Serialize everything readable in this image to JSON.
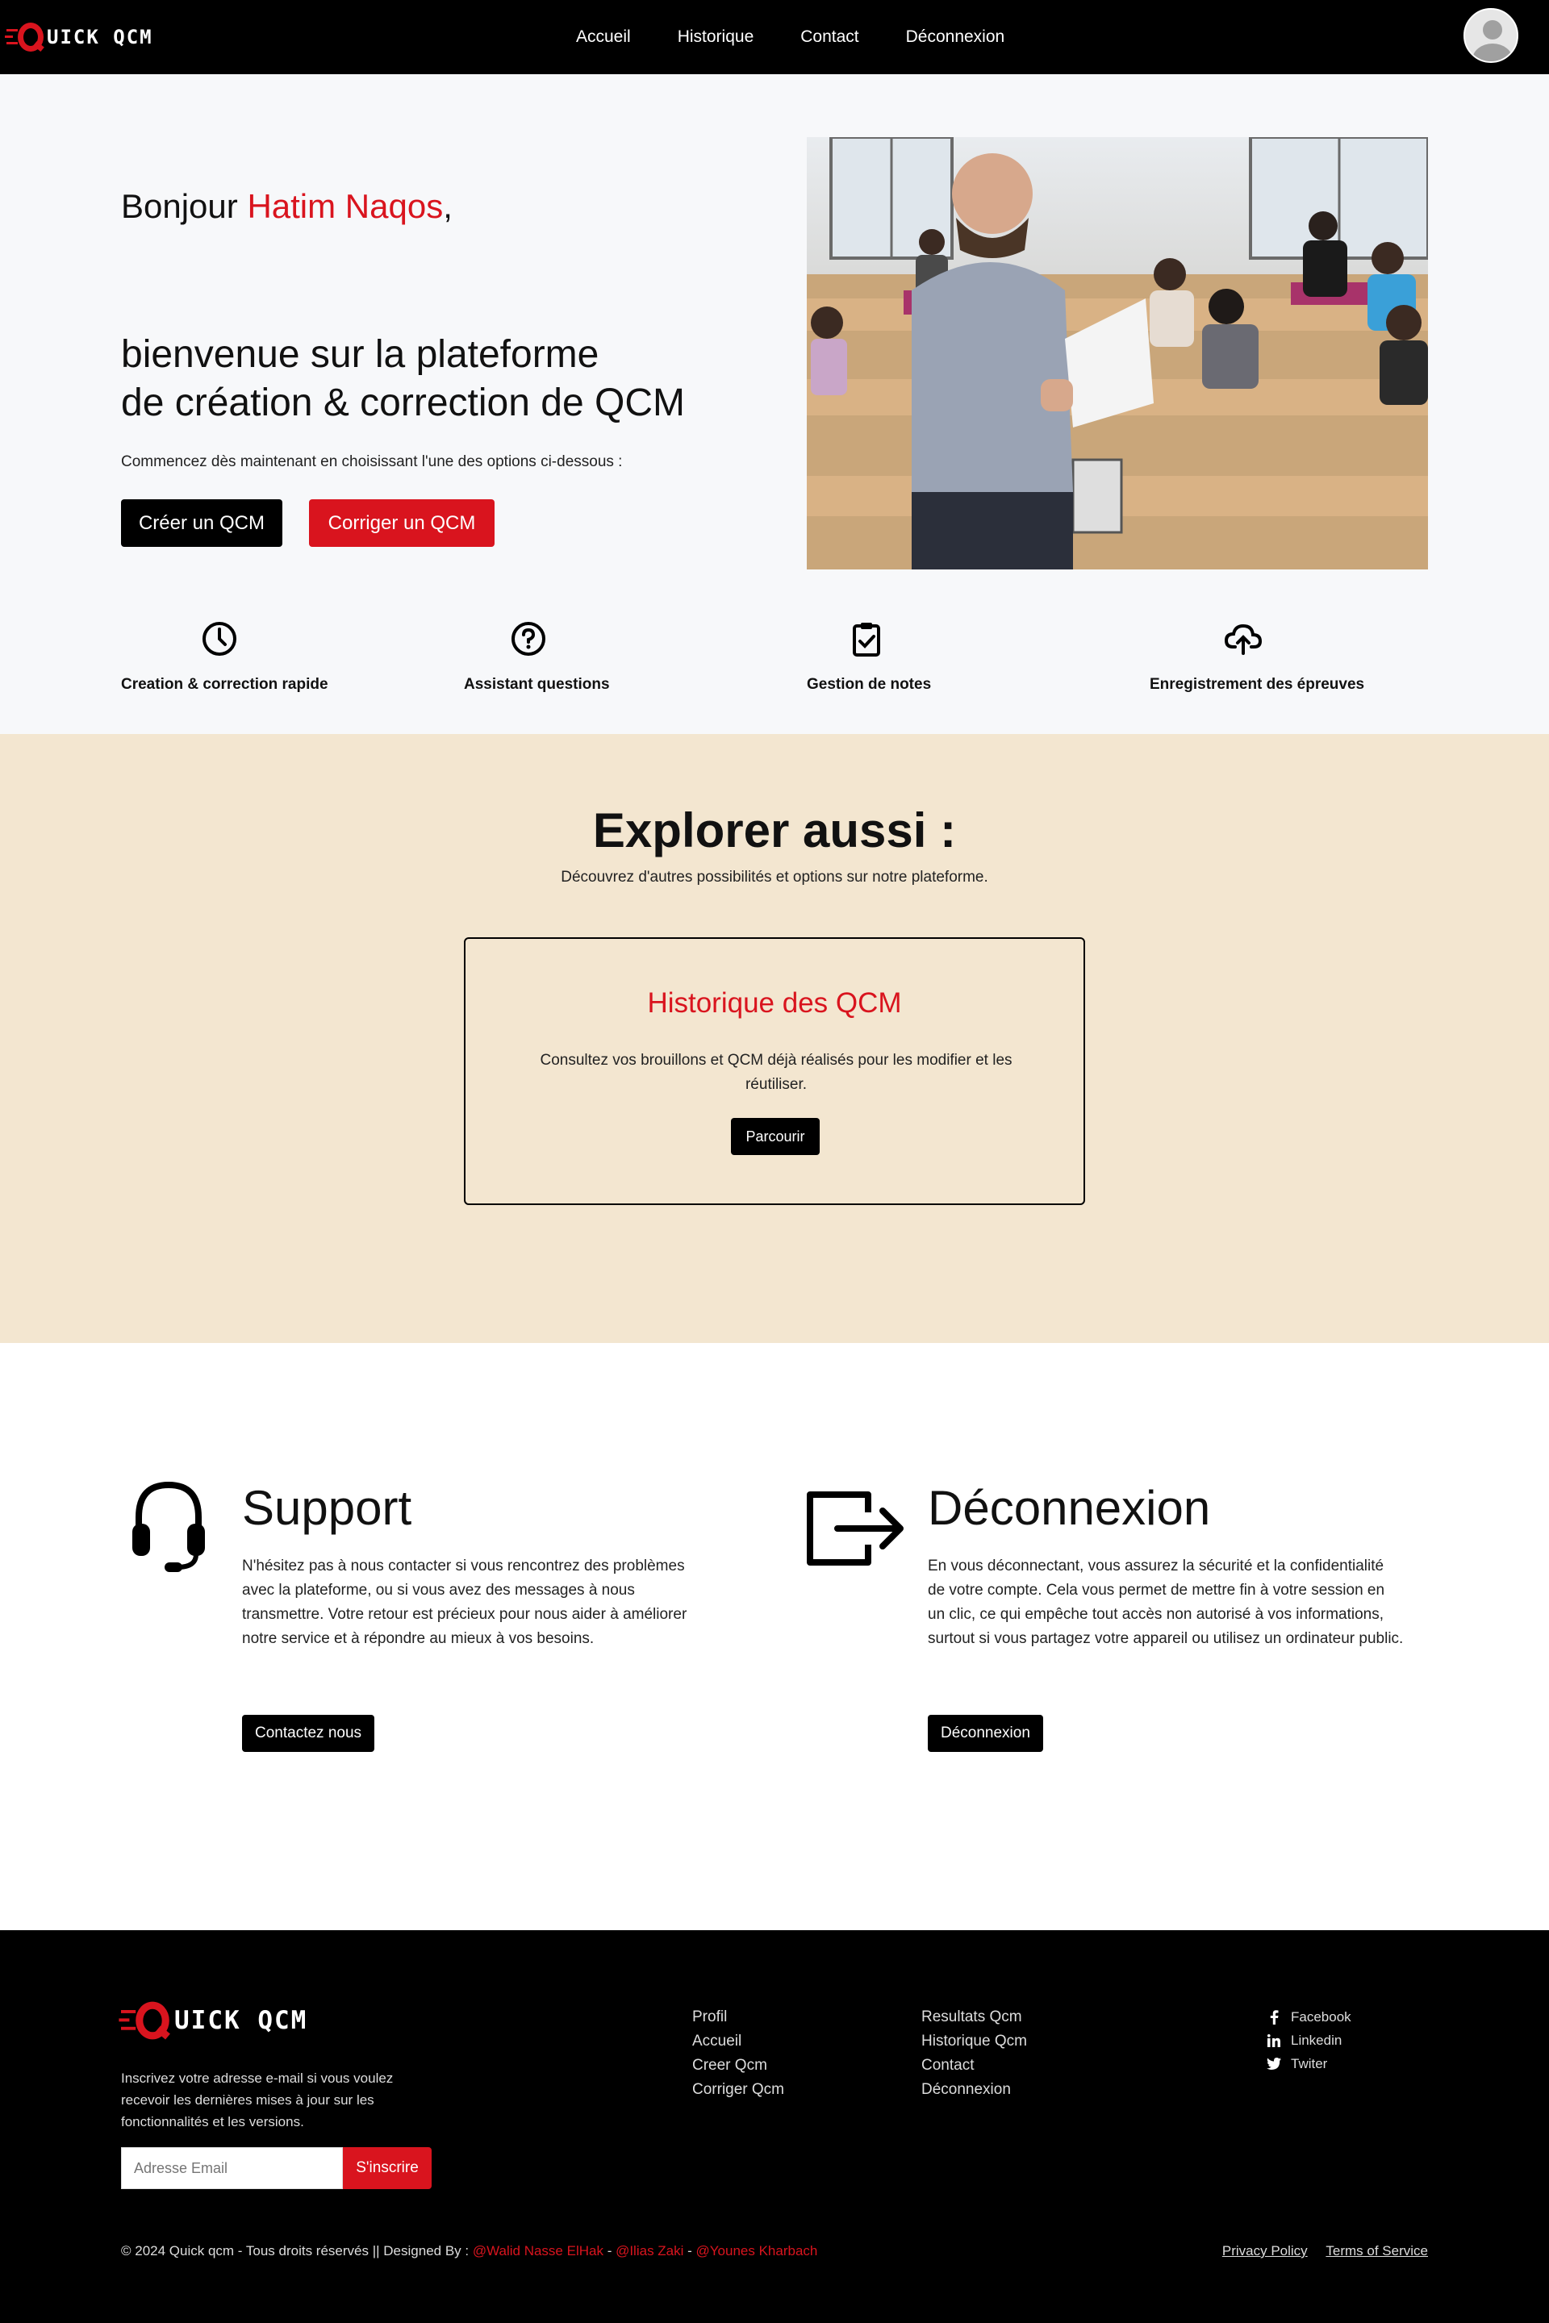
{
  "brand": {
    "name": "UICK QCM",
    "accent_color": "#d9141e"
  },
  "nav": {
    "items": [
      "Accueil",
      "Historique",
      "Contact",
      "Déconnexion"
    ],
    "avatar_icon": "user-avatar-icon"
  },
  "hero": {
    "greeting_prefix": "Bonjour ",
    "user_name": "Hatim Naqos",
    "greeting_suffix": ",",
    "welcome_line1": "bienvenue sur la plateforme",
    "welcome_line2": "de création & correction de QCM",
    "subtitle": "Commencez dès maintenant en choisissant l'une des options ci-dessous :",
    "create_label": "Créer un QCM",
    "correct_label": "Corriger un QCM"
  },
  "features": [
    {
      "icon": "clock-icon",
      "label": "Creation & correction rapide"
    },
    {
      "icon": "question-circle-icon",
      "label": "Assistant questions"
    },
    {
      "icon": "clipboard-check-icon",
      "label": "Gestion de notes"
    },
    {
      "icon": "cloud-upload-icon",
      "label": "Enregistrement des épreuves"
    }
  ],
  "explore": {
    "title": "Explorer aussi :",
    "subtitle": "Découvrez d'autres possibilités et options sur notre plateforme.",
    "card_title": "Historique des QCM",
    "card_text": "Consultez vos brouillons et QCM déjà réalisés pour les modifier et les réutiliser.",
    "card_button": "Parcourir"
  },
  "support": {
    "icon": "headset-icon",
    "title": "Support",
    "text": "N'hésitez pas à nous contacter si vous rencontrez des problèmes avec la plateforme, ou si vous avez des messages à nous transmettre. Votre retour est précieux pour nous aider à améliorer notre service et à répondre au mieux à vos besoins.",
    "button": "Contactez nous"
  },
  "logout": {
    "icon": "logout-icon",
    "title": "Déconnexion",
    "text": "En vous déconnectant, vous assurez la sécurité et la confidentialité de votre compte. Cela vous permet de mettre fin à votre session en un clic, ce qui empêche tout accès non autorisé à vos informations, surtout si vous partagez votre appareil ou utilisez un ordinateur public.",
    "button": "Déconnexion"
  },
  "footer": {
    "description": "Inscrivez votre adresse e-mail si vous voulez recevoir les dernières mises à jour sur les fonctionnalités et les versions.",
    "email_placeholder": "Adresse Email",
    "subscribe_label": "S'inscrire",
    "col1": [
      "Profil",
      "Accueil",
      "Creer Qcm",
      "Corriger Qcm"
    ],
    "col2": [
      "Resultats Qcm",
      "Historique Qcm",
      "Contact",
      "Déconnexion"
    ],
    "social": [
      {
        "icon": "facebook-icon",
        "label": "Facebook"
      },
      {
        "icon": "linkedin-icon",
        "label": "Linkedin"
      },
      {
        "icon": "twitter-icon",
        "label": "Twiter"
      }
    ],
    "copyright_prefix": "© 2024 Quick qcm - Tous droits réservés || Designed By : ",
    "developers": [
      "@Walid Nasse ElHak",
      "@Ilias Zaki",
      "@Younes Kharbach"
    ],
    "separator": " - ",
    "privacy": "Privacy Policy",
    "terms": "Terms of Service"
  }
}
